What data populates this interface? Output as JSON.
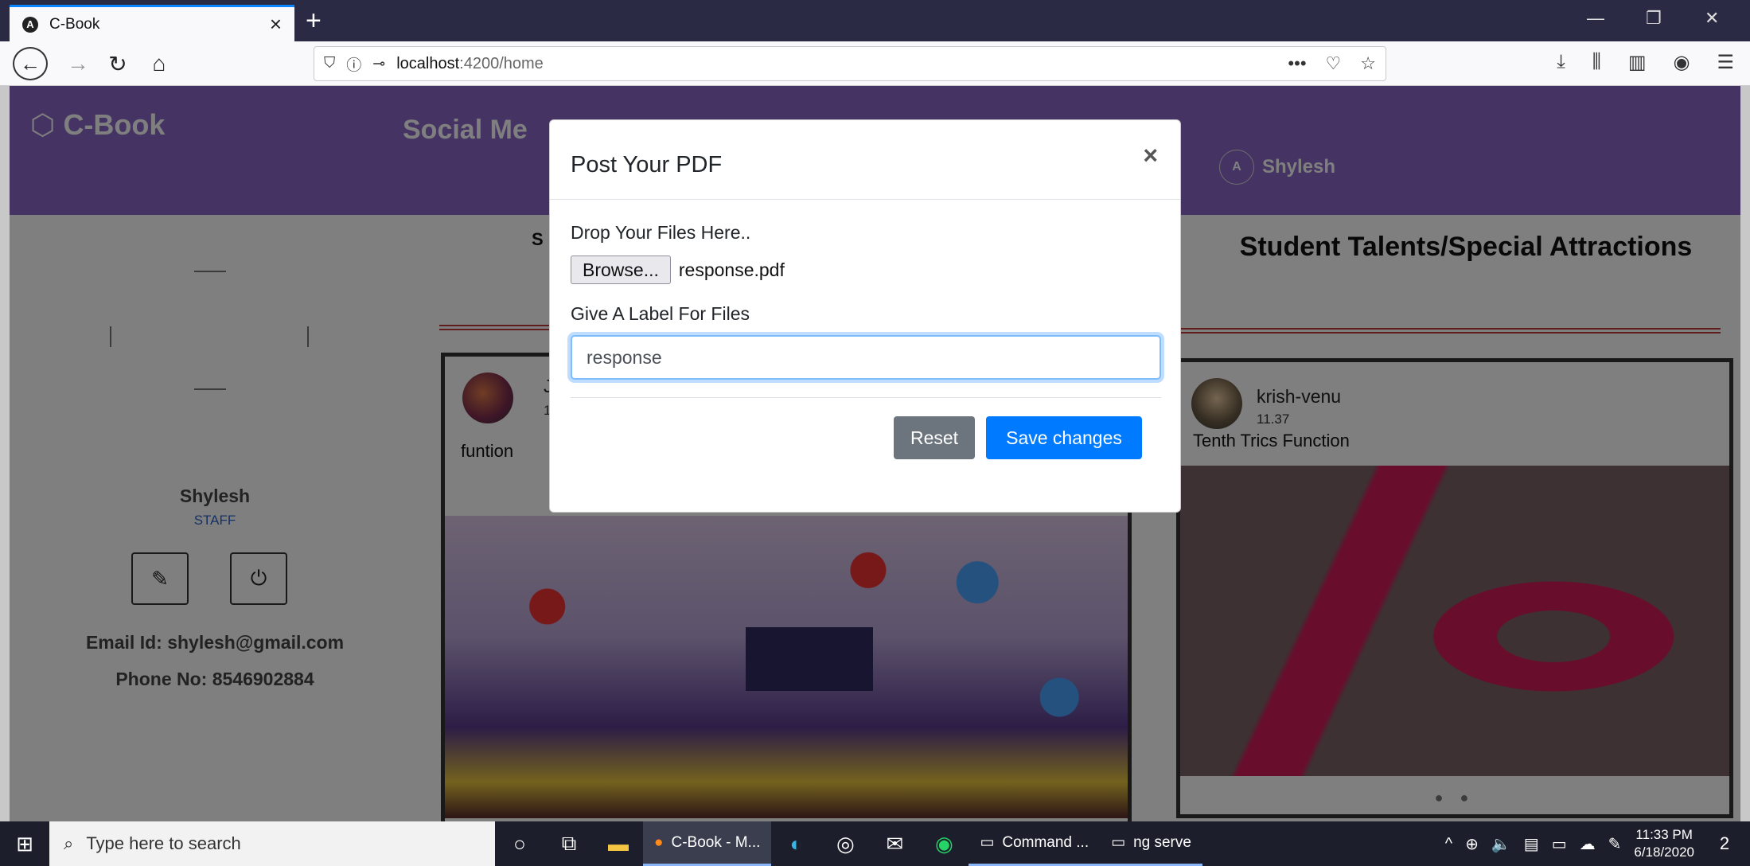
{
  "browser": {
    "tab_title": "C-Book",
    "tab_close": "×",
    "new_tab": "+",
    "url_host": "localhost",
    "url_path": ":4200/home",
    "url_more": "•••",
    "win_min": "—",
    "win_restore": "❐",
    "win_close": "✕"
  },
  "header": {
    "logo": "C-Book",
    "site_title": "Social Me",
    "avatar_alt": "A",
    "user_name": "Shylesh"
  },
  "sidebar": {
    "name": "Shylesh",
    "role": "STAFF",
    "email": "Email Id: shylesh@gmail.com",
    "phone": "Phone No: 8546902884"
  },
  "feed": {
    "title_fragment": "S",
    "post": {
      "user_fragment": "J",
      "time_fragment": "1",
      "caption": "funtion"
    }
  },
  "talents": {
    "title": "Student Talents/Special Attractions",
    "post": {
      "user": "krish-venu",
      "time": "11.37",
      "caption": "Tenth Trics Function",
      "dots": "● ●"
    }
  },
  "modal": {
    "title": "Post Your PDF",
    "close": "×",
    "drop_label": "Drop Your Files Here..",
    "browse_label": "Browse...",
    "file_name": "response.pdf",
    "label_prompt": "Give A Label For Files",
    "label_value": "response",
    "reset_label": "Reset",
    "save_label": "Save changes"
  },
  "taskbar": {
    "search_placeholder": "Type here to search",
    "apps": [
      {
        "label": "C-Book - M..."
      },
      {
        "label": "Command ..."
      },
      {
        "label": "ng serve"
      }
    ],
    "time": "11:33 PM",
    "date": "6/18/2020",
    "notifications": "2"
  }
}
